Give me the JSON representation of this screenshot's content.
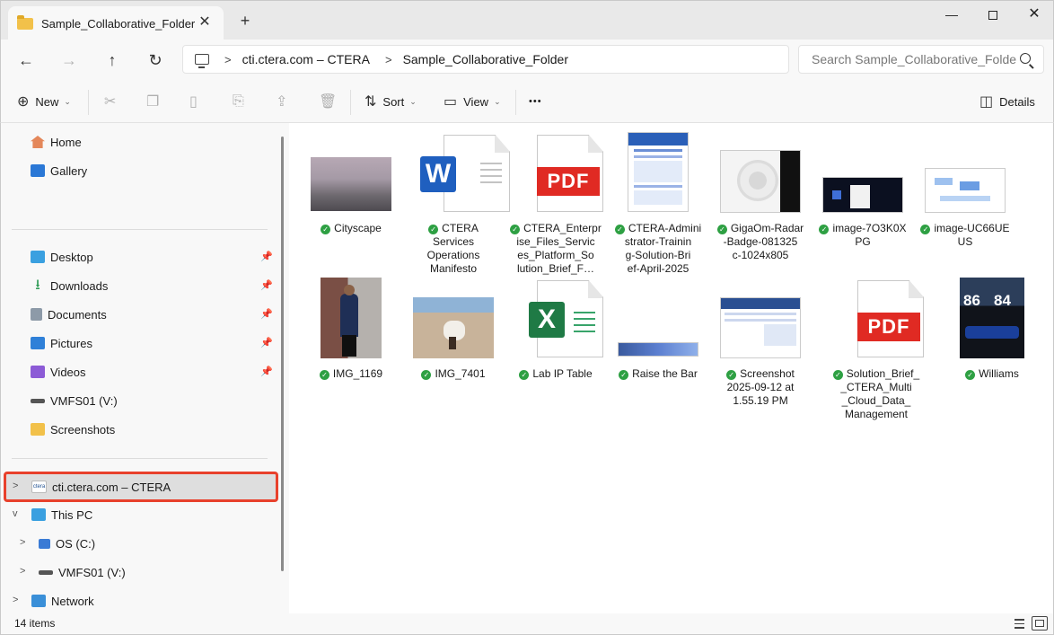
{
  "window": {
    "tab_title": "Sample_Collaborative_Folder",
    "close_glyph": "✕",
    "new_tab_glyph": "+",
    "minimize_glyph": "—",
    "close_window_glyph": "✕"
  },
  "nav_buttons": {
    "back": "←",
    "forward": "→",
    "up": "↑",
    "refresh": "↻"
  },
  "address": {
    "separator": ">",
    "crumbs": [
      "cti.ctera.com – CTERA",
      "Sample_Collaborative_Folder"
    ]
  },
  "search": {
    "placeholder": "Search Sample_Collaborative_Folde"
  },
  "commandbar": {
    "new_label": "New",
    "sort_label": "Sort",
    "view_label": "View",
    "more_glyph": "•••",
    "details_label": "Details"
  },
  "navpane": {
    "top": [
      {
        "label": "Home",
        "icon": "home-icon"
      },
      {
        "label": "Gallery",
        "icon": "gallery-icon"
      }
    ],
    "quick": [
      {
        "label": "Desktop",
        "icon": "desktop-icon",
        "pinned": true
      },
      {
        "label": "Downloads",
        "icon": "downloads-icon",
        "pinned": true
      },
      {
        "label": "Documents",
        "icon": "documents-icon",
        "pinned": true
      },
      {
        "label": "Pictures",
        "icon": "pictures-icon",
        "pinned": true
      },
      {
        "label": "Videos",
        "icon": "videos-icon",
        "pinned": true
      },
      {
        "label": "VMFS01 (V:)",
        "icon": "drive-icon",
        "pinned": false
      },
      {
        "label": "Screenshots",
        "icon": "folder-icon",
        "pinned": false
      }
    ],
    "tree": [
      {
        "label": "cti.ctera.com – CTERA",
        "icon": "ctera-icon",
        "expander": ">",
        "selected": true
      },
      {
        "label": "This PC",
        "icon": "pc-icon",
        "expander": "v"
      },
      {
        "label": "OS (C:)",
        "icon": "os-drive-icon",
        "expander": ">"
      },
      {
        "label": "VMFS01 (V:)",
        "icon": "drive-icon",
        "expander": ">"
      },
      {
        "label": "Network",
        "icon": "network-icon",
        "expander": ">"
      }
    ],
    "pin_glyph": "📌",
    "ctera_logo_text": "ctera"
  },
  "files": [
    {
      "name": "Cityscape",
      "lines": [
        "Cityscape"
      ],
      "kind": "photo"
    },
    {
      "name": "CTERA Services Operations Manifesto",
      "lines": [
        "CTERA",
        "Services",
        "Operations",
        "Manifesto"
      ],
      "kind": "word"
    },
    {
      "name": "CTERA_Enterprise_Files_Services_Platform_Solution_Brief_F…",
      "lines": [
        "CTERA_Enterpr",
        "ise_Files_Servic",
        "es_Platform_So",
        "lution_Brief_F…"
      ],
      "kind": "pdf"
    },
    {
      "name": "CTERA-Administrator-Training-Solution-Brief-April-2025",
      "lines": [
        "CTERA-Admini",
        "strator-Trainin",
        "g-Solution-Bri",
        "ef-April-2025"
      ],
      "kind": "doc-preview"
    },
    {
      "name": "GigaOm-Radar-Badge-081325c-1024x805",
      "lines": [
        "GigaOm-Radar",
        "-Badge-081325",
        "c-1024x805"
      ],
      "kind": "image"
    },
    {
      "name": "image-7O3K0XPG",
      "lines": [
        "image-7O3K0X",
        "PG"
      ],
      "kind": "image"
    },
    {
      "name": "image-UC66UEUS",
      "lines": [
        "image-UC66UE",
        "US"
      ],
      "kind": "image"
    },
    {
      "name": "IMG_1169",
      "lines": [
        "IMG_1169"
      ],
      "kind": "photo"
    },
    {
      "name": "IMG_7401",
      "lines": [
        "IMG_7401"
      ],
      "kind": "photo"
    },
    {
      "name": "Lab IP Table",
      "lines": [
        "Lab IP Table"
      ],
      "kind": "excel"
    },
    {
      "name": "Raise the Bar",
      "lines": [
        "Raise the Bar"
      ],
      "kind": "image"
    },
    {
      "name": "Screenshot 2025-09-12 at 1.55.19 PM",
      "lines": [
        "Screenshot",
        "2025-09-12 at",
        "1.55.19 PM"
      ],
      "kind": "image"
    },
    {
      "name": "Solution_Brief__CTERA_Multi_Cloud_Data_Management",
      "lines": [
        "Solution_Brief_",
        "_CTERA_Multi",
        "_Cloud_Data_",
        "Management"
      ],
      "kind": "pdf"
    },
    {
      "name": "Williams",
      "lines": [
        "Williams"
      ],
      "kind": "photo"
    }
  ],
  "badges": {
    "word": "W",
    "excel": "X",
    "pdf": "PDF",
    "williams_a": "86",
    "williams_b": "84"
  },
  "status": {
    "item_count": "14 items"
  },
  "colors": {
    "sync_ok": "#2ea043",
    "selection_outline": "#e8412c",
    "folder": "#f2c14a",
    "pdf": "#e02a23",
    "word": "#1f5fbf",
    "excel": "#1f7a45"
  }
}
